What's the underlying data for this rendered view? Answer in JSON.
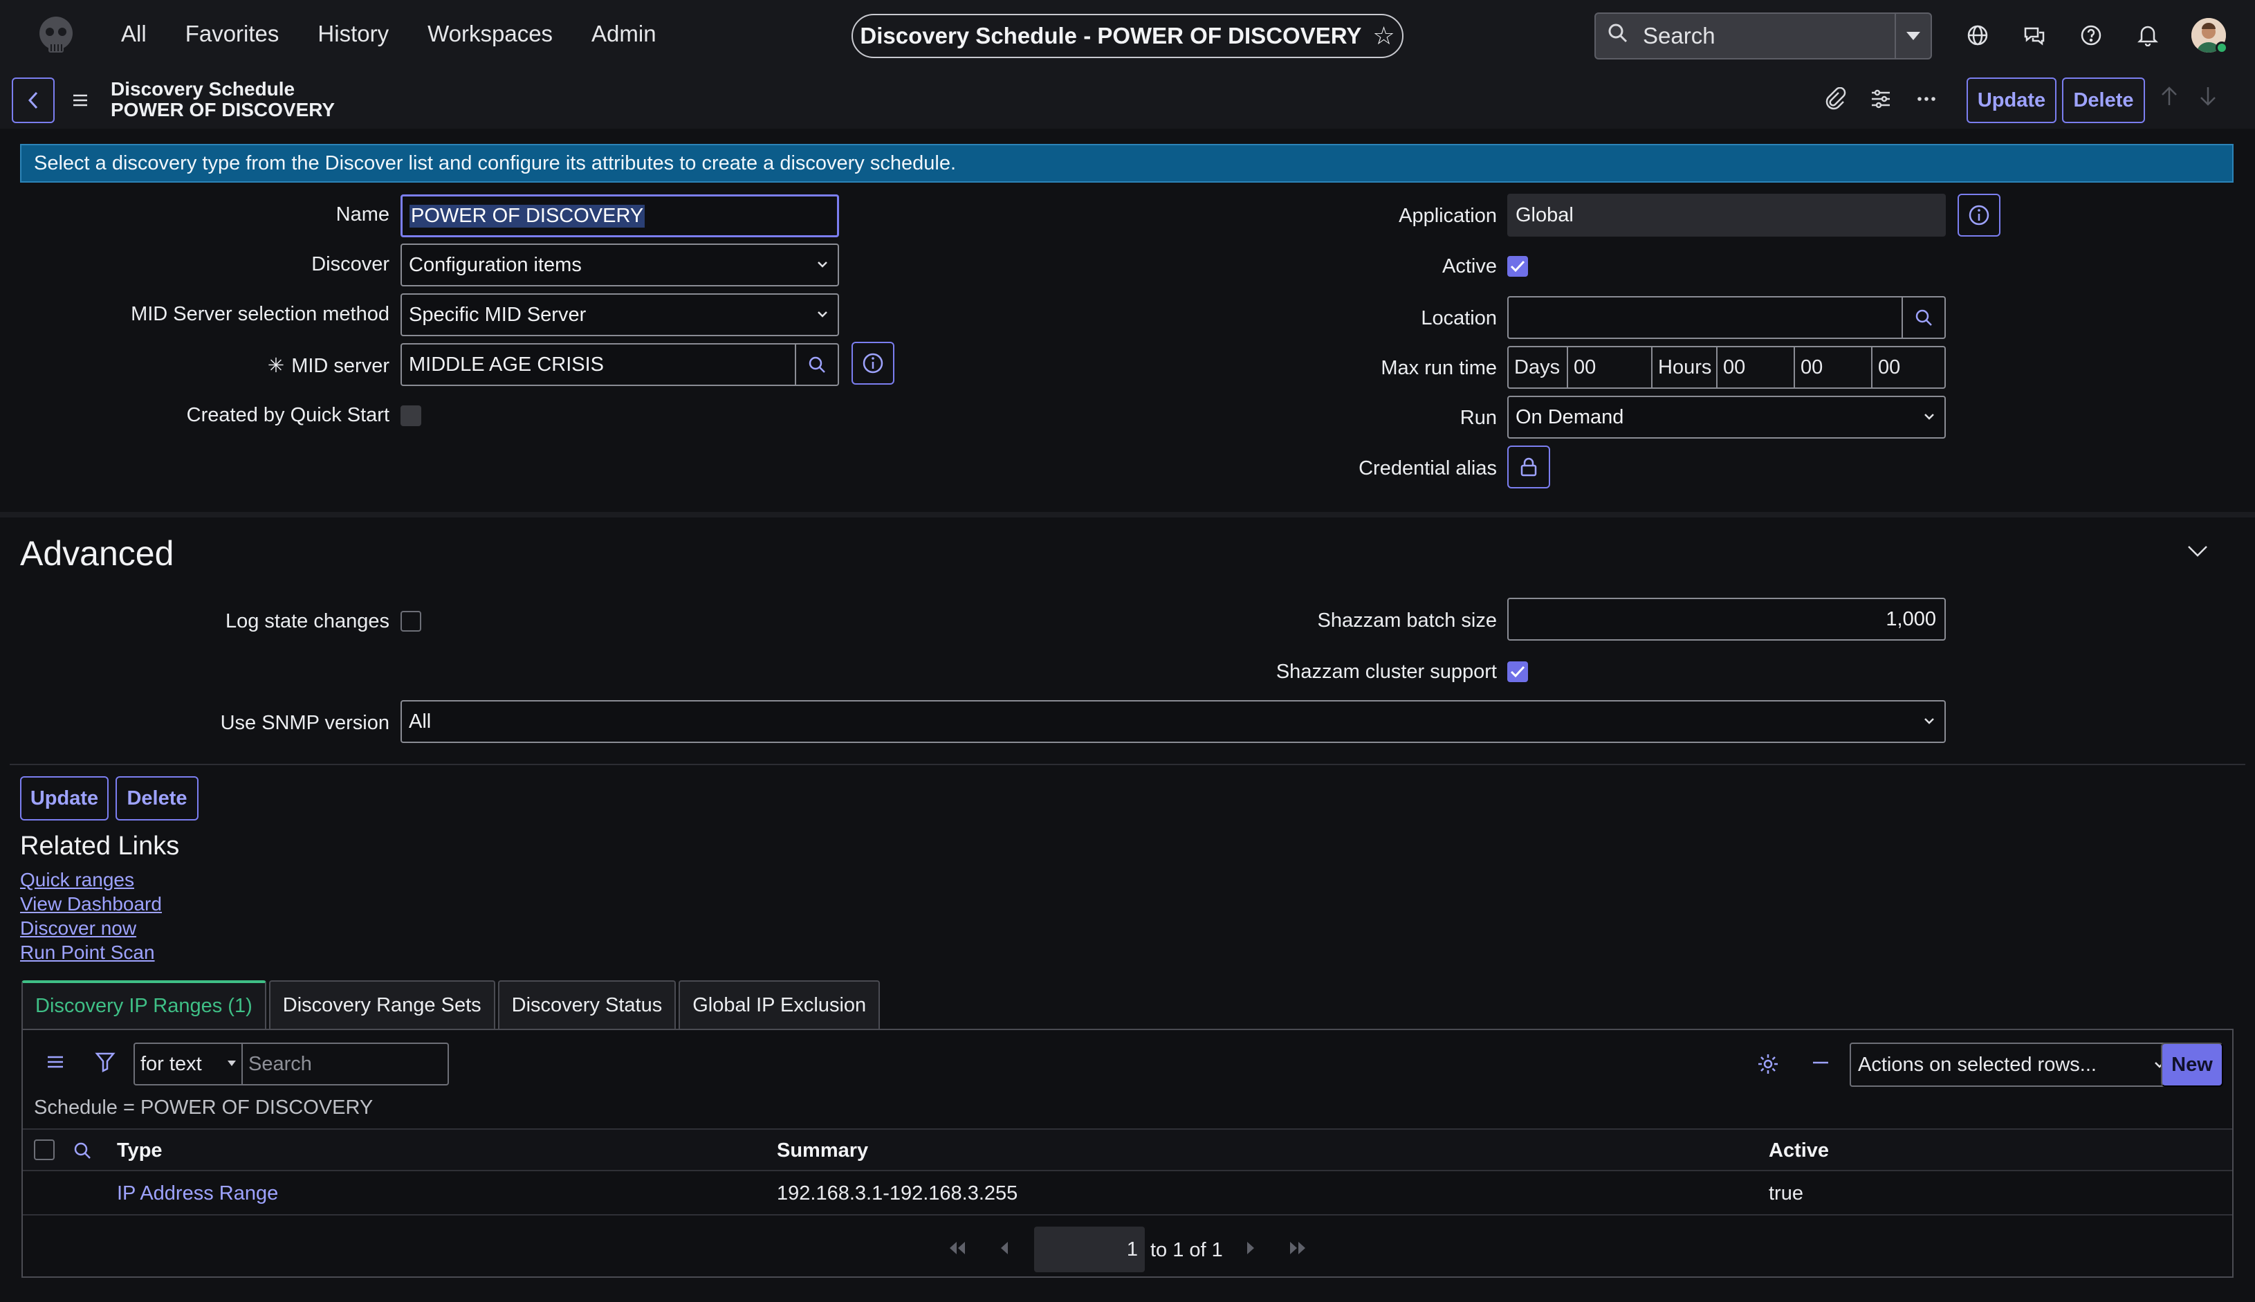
{
  "topnav": {
    "menu": [
      "All",
      "Favorites",
      "History",
      "Workspaces",
      "Admin"
    ],
    "title": "Discovery Schedule - POWER OF DISCOVERY",
    "search_placeholder": "Search"
  },
  "formheader": {
    "line1": "Discovery Schedule",
    "line2": "POWER OF DISCOVERY",
    "update": "Update",
    "delete": "Delete"
  },
  "banner": "Select a discovery type from the Discover list and configure its attributes to create a discovery schedule.",
  "form": {
    "name_label": "Name",
    "name_value": "POWER OF DISCOVERY",
    "discover_label": "Discover",
    "discover_value": "Configuration items",
    "mid_method_label": "MID Server selection method",
    "mid_method_value": "Specific MID Server",
    "mid_server_label": "MID server",
    "mid_server_value": "MIDDLE AGE CRISIS",
    "quickstart_label": "Created by Quick Start",
    "application_label": "Application",
    "application_value": "Global",
    "active_label": "Active",
    "location_label": "Location",
    "location_value": "",
    "maxrun_label": "Max run time",
    "maxrun": {
      "days_label": "Days",
      "days": "00",
      "hours_label": "Hours",
      "hours": "00",
      "minutes": "00",
      "seconds": "00"
    },
    "run_label": "Run",
    "run_value": "On Demand",
    "credential_label": "Credential alias"
  },
  "advanced": {
    "title": "Advanced",
    "log_label": "Log state changes",
    "batch_label": "Shazzam batch size",
    "batch_value": "1,000",
    "cluster_label": "Shazzam cluster support",
    "snmp_label": "Use SNMP version",
    "snmp_value": "All"
  },
  "bottom_buttons": {
    "update": "Update",
    "delete": "Delete"
  },
  "related": {
    "title": "Related Links",
    "links": [
      "Quick ranges",
      "View Dashboard",
      "Discover now",
      "Run Point Scan"
    ]
  },
  "tabs": [
    "Discovery IP Ranges (1)",
    "Discovery Range Sets",
    "Discovery Status",
    "Global IP Exclusion"
  ],
  "list": {
    "filter_field": "for text",
    "search_placeholder": "Search",
    "actions": "Actions on selected rows...",
    "new": "New",
    "breadcrumb": "Schedule = POWER OF DISCOVERY",
    "columns": [
      "Type",
      "Summary",
      "Active"
    ],
    "rows": [
      {
        "type": "IP Address Range",
        "summary": "192.168.3.1-192.168.3.255",
        "active": "true"
      }
    ],
    "page": "1",
    "page_text": "to 1 of 1"
  },
  "colors": {
    "accent": "#7b7ef0",
    "active_tab": "#3fbf86",
    "banner": "#0c5c8a"
  }
}
